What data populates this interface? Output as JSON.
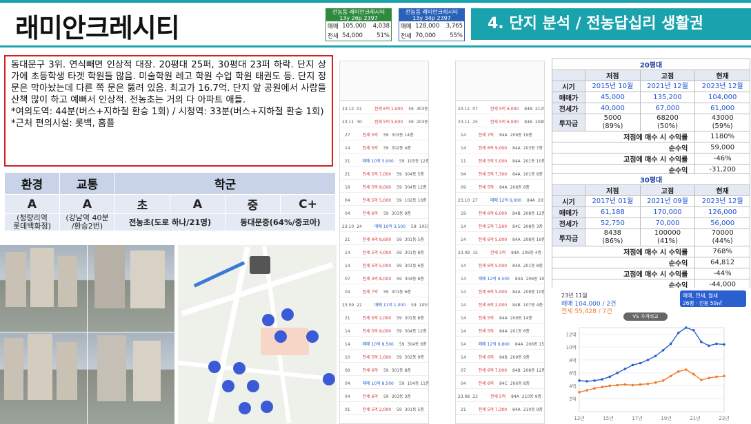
{
  "header": {
    "title": "래미안크레시티",
    "section": "4. 단지 분석 / 전농답십리 생활권"
  },
  "mini_cards": [
    {
      "name": "전농동 래미안크레시티",
      "sub": "13y  26p  2397",
      "row1": [
        "매매",
        "105,000",
        "4,038"
      ],
      "row2": [
        "전세",
        "54,000",
        "51%"
      ],
      "color": "#2d8a3e"
    },
    {
      "name": "전농동 래미안크레시티",
      "sub": "13y  34p  2397",
      "row1": [
        "매매",
        "128,000",
        "3,765"
      ],
      "row2": [
        "전세",
        "70,000",
        "55%"
      ],
      "color": "#2a62b8"
    }
  ],
  "description": [
    "동대문구 3위. 연식빼면 인상적 대장. 20평대 25퍼, 30평대 23퍼 하락. 단지 상가에 초등학생 타겟 학원들 많음. 미술학원 레고 학원 수업 학원 태권도 등. 단지 정문은 막아놨는데 다른 쪽 문은 뚫려 있음. 최고가 16.7억. 단지 앞 공원에서 사람들 산책 많이 하고 예뻐서 인상적. 전농초는 거의 다 아파트 애들.",
    "*여의도역: 44분(버스+지하철 환승 1회) / 시청역: 33분(버스+지하철 환승 1회)",
    "*근처 편의시설: 롯백, 홈플"
  ],
  "rating": {
    "headers": [
      "환경",
      "교통",
      "학군"
    ],
    "env_grade": "A",
    "env_note": "(청량리역\n롯데백화점)",
    "trans_grade": "A",
    "trans_note": "(강남역 40분\n/환승2번)",
    "school_labels": [
      "초",
      "A",
      "중",
      "C+"
    ],
    "elem": "전농초(도로 하나/21명)",
    "middle": "동대문중(64%/중코아)"
  },
  "tx_lists": [
    {
      "rows": [
        [
          "23.12",
          "01",
          "",
          "전세 6억 1,000",
          "59",
          "303동 14층"
        ],
        [
          "23.11",
          "30",
          "",
          "전세 5억 5,000",
          "59",
          "203동 18층"
        ],
        [
          "",
          "27",
          "",
          "전세 5억",
          "59",
          "303동 14층"
        ],
        [
          "",
          "14",
          "",
          "전세 5억",
          "59",
          "302동 4층"
        ],
        [
          "",
          "21",
          "",
          "매매 10억 5,000",
          "59",
          "105동 12층"
        ],
        [
          "",
          "21",
          "",
          "전세 5억 7,000",
          "59",
          "304동 5층"
        ],
        [
          "",
          "18",
          "",
          "전세 5억 8,000",
          "59",
          "304동 12층"
        ],
        [
          "",
          "04",
          "",
          "전세 5억 5,000",
          "59",
          "102동 10층"
        ],
        [
          "",
          "04",
          "",
          "전세 6억",
          "59",
          "303동 9층"
        ],
        [
          "23.10",
          "24",
          "",
          "매매 10억 3,500",
          "59",
          "105동 8층"
        ],
        [
          "",
          "21",
          "",
          "전세 4억 8,600",
          "59",
          "301동 5층"
        ],
        [
          "",
          "14",
          "",
          "전세 5억 4,000",
          "59",
          "301동 8층"
        ],
        [
          "",
          "14",
          "",
          "전세 5억 5,000",
          "59",
          "301동 6층"
        ],
        [
          "",
          "07",
          "",
          "전세 4억 8,000",
          "59",
          "304동 8층"
        ],
        [
          "",
          "04",
          "",
          "전세 7억",
          "59",
          "301동 6층"
        ],
        [
          "23.09",
          "22",
          "",
          "매매 11억 1,000",
          "59",
          "105동 12층"
        ],
        [
          "",
          "21",
          "",
          "전세 5억 2,000",
          "59",
          "301동 8층"
        ],
        [
          "",
          "14",
          "",
          "전세 5억 8,000",
          "59",
          "304동 12층"
        ],
        [
          "",
          "14",
          "",
          "매매 10억 8,500",
          "59",
          "304동 6층"
        ],
        [
          "",
          "10",
          "",
          "전세 5억 1,000",
          "59",
          "302동 9층"
        ],
        [
          "",
          "09",
          "",
          "전세 6억",
          "59",
          "301동 8층"
        ],
        [
          "",
          "04",
          "",
          "매매 10억 8,500",
          "59",
          "104동 11층"
        ],
        [
          "",
          "04",
          "",
          "전세 6억",
          "59",
          "303동 3층"
        ],
        [
          "",
          "01",
          "",
          "전세 5억 2,000",
          "59",
          "301동 5층"
        ]
      ]
    },
    {
      "rows": [
        [
          "23.12",
          "07",
          "",
          "전세 5억 6,000",
          "84B",
          "212동 10층"
        ],
        [
          "23.11",
          "25",
          "",
          "전세 5억 6,000",
          "84B",
          "208동 8층"
        ],
        [
          "",
          "14",
          "",
          "전세 7억",
          "84A",
          "206동 19층"
        ],
        [
          "",
          "14",
          "",
          "전세 6억 9,000",
          "84A",
          "203동 7층"
        ],
        [
          "",
          "11",
          "",
          "전세 5억 5,000",
          "84A",
          "201동 10층"
        ],
        [
          "",
          "04",
          "",
          "전세 5억 7,300",
          "84A",
          "201동 8층"
        ],
        [
          "",
          "09",
          "",
          "전세 5억",
          "84A",
          "208동 8층"
        ],
        [
          "23.10",
          "27",
          "",
          "매매 12억 6,000",
          "84A",
          "201동 17층"
        ],
        [
          "",
          "19",
          "",
          "전세 6억 6,000",
          "84B",
          "208동 12층"
        ],
        [
          "",
          "14",
          "",
          "전세 5억 7,500",
          "84C",
          "208동 3층"
        ],
        [
          "",
          "14",
          "",
          "전세 6억 5,000",
          "84A",
          "208동 19층"
        ],
        [
          "23.09",
          "15",
          "",
          "전세 3억",
          "84A",
          "206동 4층"
        ],
        [
          "",
          "14",
          "",
          "전세 6억 5,000",
          "84A",
          "201동 8층"
        ],
        [
          "",
          "14",
          "",
          "매매 12억 9,500",
          "84A",
          "206동 19층"
        ],
        [
          "",
          "14",
          "",
          "전세 6억 5,000",
          "84A",
          "208동 10층"
        ],
        [
          "",
          "14",
          "",
          "전세 6억 2,000",
          "84B",
          "107동 4층"
        ],
        [
          "",
          "14",
          "",
          "전세 5억",
          "84A",
          "209동 14층"
        ],
        [
          "",
          "14",
          "",
          "전세 5억",
          "84A",
          "201동 6층"
        ],
        [
          "",
          "14",
          "",
          "매매 12억 9,800",
          "84A",
          "206동 15층"
        ],
        [
          "",
          "14",
          "",
          "전세 6억",
          "84B",
          "209동 9층"
        ],
        [
          "",
          "07",
          "",
          "전세 6억 7,000",
          "84B",
          "208동 12층"
        ],
        [
          "",
          "04",
          "",
          "전세 6억",
          "84C",
          "206동 8층"
        ],
        [
          "23.08",
          "23",
          "",
          "전세 5억",
          "84A",
          "210동 9층"
        ],
        [
          "",
          "21",
          "",
          "전세 5억 7,300",
          "84A",
          "210동 9층"
        ]
      ]
    }
  ],
  "stat20": {
    "caption": "20평대",
    "cols": [
      "저점",
      "고점",
      "현재"
    ],
    "rows": [
      {
        "label": "시기",
        "vals": [
          "2015년 10월",
          "2021년 12월",
          "2023년 12월"
        ],
        "blue": true
      },
      {
        "label": "매매가",
        "vals": [
          "45,000",
          "135,200",
          "104,000"
        ],
        "blue": true
      },
      {
        "label": "전세가",
        "vals": [
          "40,000",
          "67,000",
          "61,000"
        ],
        "blue": true
      },
      {
        "label": "투자금",
        "vals": [
          "5000\n(89%)",
          "68200\n(50%)",
          "43000\n(59%)"
        ],
        "blue": false
      }
    ],
    "summary": [
      [
        "저점에 매수 시 수익률",
        "1180%"
      ],
      [
        "순수익",
        "59,000"
      ],
      [
        "고점에 매수 시 수익률",
        "-46%"
      ],
      [
        "순수익",
        "-31,200"
      ]
    ]
  },
  "stat30": {
    "caption": "30평대",
    "cols": [
      "저점",
      "고점",
      "현재"
    ],
    "rows": [
      {
        "label": "시기",
        "vals": [
          "2017년 01월",
          "2021년 09월",
          "2023년 12월"
        ],
        "blue": true
      },
      {
        "label": "매매가",
        "vals": [
          "61,188",
          "170,000",
          "126,000"
        ],
        "blue": true
      },
      {
        "label": "전세가",
        "vals": [
          "52,750",
          "70,000",
          "56,000"
        ],
        "blue": true
      },
      {
        "label": "투자금",
        "vals": [
          "8438\n(86%)",
          "100000\n(41%)",
          "70000\n(44%)"
        ],
        "blue": false
      }
    ],
    "summary": [
      [
        "저점에 매수 시 수익률",
        "768%"
      ],
      [
        "순수익",
        "64,812"
      ],
      [
        "고점에 매수 시 수익률",
        "-44%"
      ],
      [
        "순수익",
        "-44,000"
      ]
    ]
  },
  "chart_data": {
    "type": "line",
    "title": "23년 11월",
    "header_lines": [
      "매매 104,000 / 2건",
      "전세 55,428 / 7건"
    ],
    "filter_label": "매매, 전세, 월세",
    "filter_sub": "26평 · 전용 59㎡",
    "compare_button": "VS 가격비교",
    "x": [
      "13년",
      "15년",
      "17년",
      "19년",
      "21년",
      "23년"
    ],
    "yticks": [
      "2억",
      "4억",
      "6억",
      "8억",
      "10억",
      "12억"
    ],
    "ylim": [
      0,
      13
    ],
    "series": [
      {
        "name": "매매",
        "color": "#2a5fd0",
        "values": [
          4.8,
          4.7,
          4.8,
          5.0,
          5.4,
          6.0,
          6.6,
          7.2,
          7.5,
          8.0,
          8.6,
          9.5,
          10.5,
          12.2,
          13.0,
          12.6,
          10.8,
          10.2,
          10.5,
          10.4
        ]
      },
      {
        "name": "전세",
        "color": "#f07a2a",
        "values": [
          3.0,
          3.3,
          3.6,
          3.8,
          4.0,
          4.1,
          4.2,
          4.1,
          4.2,
          4.3,
          4.5,
          4.8,
          5.5,
          6.2,
          6.5,
          5.8,
          4.9,
          5.2,
          5.4,
          5.5
        ]
      }
    ]
  }
}
